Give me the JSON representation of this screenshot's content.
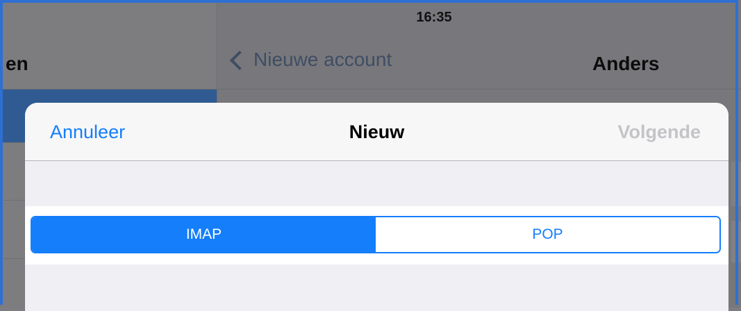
{
  "status_bar": {
    "time": "16:35"
  },
  "master": {
    "title_fragment": "en"
  },
  "detail": {
    "back_label": "Nieuwe account",
    "title": "Anders"
  },
  "sheet": {
    "cancel_label": "Annuleer",
    "title": "Nieuw",
    "next_label": "Volgende",
    "segmented": {
      "options": [
        "IMAP",
        "POP"
      ],
      "selected": "IMAP"
    }
  },
  "colors": {
    "accent": "#147efb",
    "disabled": "#c4c4c8",
    "frame": "#2f6fd1"
  }
}
